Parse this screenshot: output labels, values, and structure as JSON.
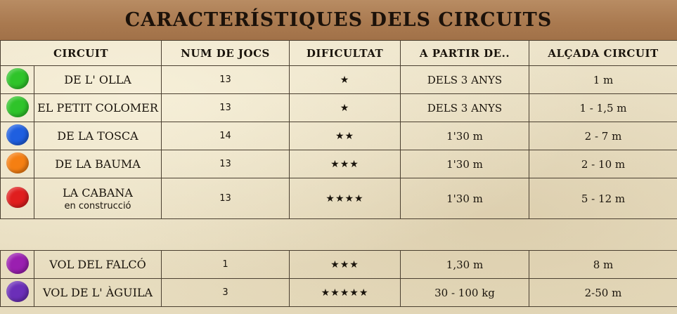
{
  "title": "CARACTERÍSTIQUES DELS CIRCUITS",
  "headers": {
    "circuit": "CIRCUIT",
    "num_jocs": "NUM DE JOCS",
    "dificultat": "DIFICULTAT",
    "a_partir": "A PARTIR DE..",
    "alcada": "ALÇADA CIRCUIT"
  },
  "rows": [
    {
      "color": "#2fc42a",
      "name": "DE L' OLLA",
      "note": "",
      "num": "13",
      "difficulty": "★",
      "from": "DELS 3 ANYS",
      "height": "1 m"
    },
    {
      "color": "#2fc42a",
      "name": "EL PETIT COLOMER",
      "note": "",
      "num": "13",
      "difficulty": "★",
      "from": "DELS 3 ANYS",
      "height": "1 - 1,5 m"
    },
    {
      "color": "#1f5fe0",
      "name": "DE LA TOSCA",
      "note": "",
      "num": "14",
      "difficulty": "★★",
      "from": "1'30 m",
      "height": "2 - 7 m"
    },
    {
      "color": "#f57f12",
      "name": "DE LA BAUMA",
      "note": "",
      "num": "13",
      "difficulty": "★★★",
      "from": "1'30 m",
      "height": "2 - 10 m"
    },
    {
      "color": "#e01e1e",
      "name": "LA CABANA",
      "note": "en construcció",
      "num": "13",
      "difficulty": "★★★★",
      "from": "1'30 m",
      "height": "5 - 12 m"
    }
  ],
  "rows2": [
    {
      "color": "#9a1fb0",
      "name": "VOL DEL FALCÓ",
      "note": "",
      "num": "1",
      "difficulty": "★★★",
      "from": "1,30 m",
      "height": "8 m"
    },
    {
      "color": "#6b2fb8",
      "name": "VOL DE L' ÀGUILA",
      "note": "",
      "num": "3",
      "difficulty": "★★★★★",
      "from": "30 - 100 kg",
      "height": "2-50 m"
    }
  ]
}
